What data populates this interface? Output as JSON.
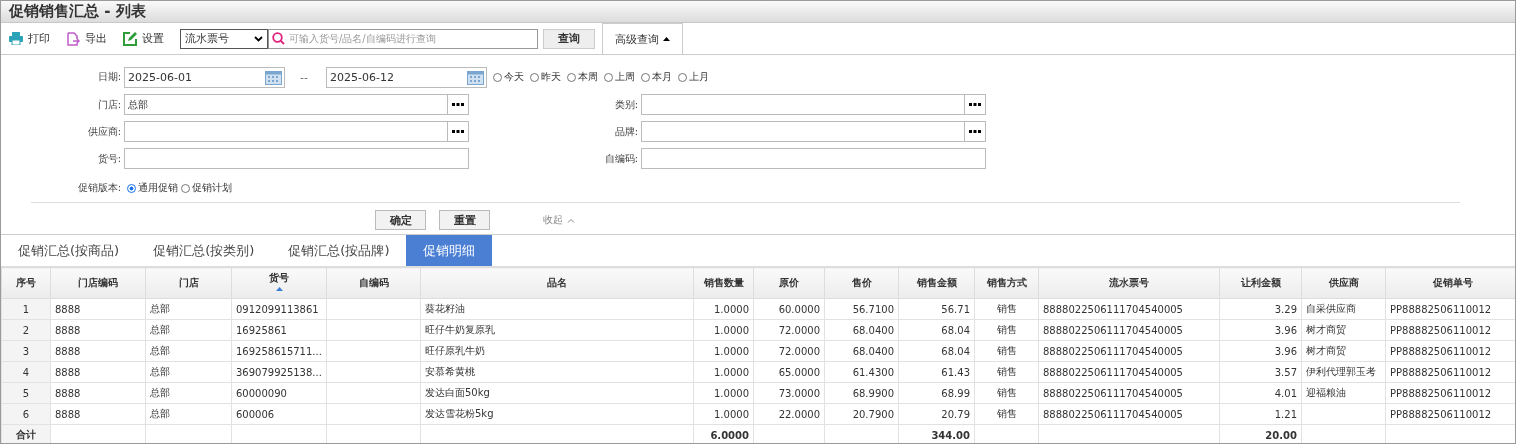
{
  "title": "促销销售汇总 - 列表",
  "toolbar": {
    "buttons": [
      {
        "label": "打印",
        "kind": "print"
      },
      {
        "label": "导出",
        "kind": "export"
      },
      {
        "label": "设置",
        "kind": "settings"
      }
    ],
    "select": {
      "value": "流水票号"
    },
    "search": {
      "placeholder": "可输入货号/品名/自编码进行查询"
    },
    "query_button": "查询",
    "advanced_tab": {
      "label": "高级查询",
      "expanded": true
    }
  },
  "filters": {
    "date": {
      "label": "日期:",
      "from": "2025-06-01",
      "separator": "--",
      "to": "2025-06-12",
      "quick": [
        {
          "label": "今天",
          "selected": false
        },
        {
          "label": "昨天",
          "selected": false
        },
        {
          "label": "本周",
          "selected": false
        },
        {
          "label": "上周",
          "selected": false
        },
        {
          "label": "本月",
          "selected": false
        },
        {
          "label": "上月",
          "selected": false
        }
      ]
    },
    "fields": [
      {
        "label": "门店:",
        "value": "总部",
        "picker": true
      },
      {
        "label": "类别:",
        "picker": true
      },
      {
        "label": "供应商:",
        "picker": true
      },
      {
        "label": "品牌:",
        "picker": true
      },
      {
        "label": "货号:",
        "picker": false
      },
      {
        "label": "自编码:",
        "picker": false
      }
    ],
    "promo_version": {
      "label": "促销版本:",
      "options": [
        {
          "label": "通用促销",
          "selected": true
        },
        {
          "label": "促销计划",
          "selected": false
        }
      ]
    },
    "confirm": "确定",
    "reset": "重置",
    "collapse": "收起"
  },
  "tabs": [
    {
      "label": "促销汇总(按商品)",
      "selected": false
    },
    {
      "label": "促销汇总(按类别)",
      "selected": false
    },
    {
      "label": "促销汇总(按品牌)",
      "selected": false
    },
    {
      "label": "促销明细",
      "selected": true
    }
  ],
  "table": {
    "columns": [
      {
        "label": "序号",
        "kind": "center",
        "sorted": false
      },
      {
        "label": "门店编码",
        "kind": "text",
        "sorted": false
      },
      {
        "label": "门店",
        "kind": "text",
        "sorted": false
      },
      {
        "label": "货号",
        "kind": "text",
        "sorted": true
      },
      {
        "label": "自编码",
        "kind": "text",
        "sorted": false
      },
      {
        "label": "品名",
        "kind": "text",
        "sorted": false
      },
      {
        "label": "销售数量",
        "kind": "number",
        "sorted": false
      },
      {
        "label": "原价",
        "kind": "number",
        "sorted": false
      },
      {
        "label": "售价",
        "kind": "number",
        "sorted": false
      },
      {
        "label": "销售金额",
        "kind": "number",
        "sorted": false
      },
      {
        "label": "销售方式",
        "kind": "center",
        "sorted": false
      },
      {
        "label": "流水票号",
        "kind": "text",
        "sorted": false
      },
      {
        "label": "让利金额",
        "kind": "number",
        "sorted": false
      },
      {
        "label": "供应商",
        "kind": "text",
        "sorted": false
      },
      {
        "label": "促销单号",
        "kind": "text",
        "sorted": false
      }
    ],
    "rows": [
      {
        "seq": "1",
        "store_code": "8888",
        "store": "总部",
        "item_no": "0912099113861",
        "name": "葵花籽油",
        "qty": "1.0000",
        "orig_price": "60.0000",
        "price": "56.7100",
        "amount": "56.71",
        "sale_type": "销售",
        "ticket_no": "8888022506111704540005",
        "discount": "3.29",
        "supplier": "自采供应商",
        "promo_no": "PP88882506110012"
      },
      {
        "seq": "2",
        "store_code": "8888",
        "store": "总部",
        "item_no": "16925861",
        "name": "旺仔牛奶复原乳",
        "qty": "1.0000",
        "orig_price": "72.0000",
        "price": "68.0400",
        "amount": "68.04",
        "sale_type": "销售",
        "ticket_no": "8888022506111704540005",
        "discount": "3.96",
        "supplier": "树才商贸",
        "promo_no": "PP88882506110012"
      },
      {
        "seq": "3",
        "store_code": "8888",
        "store": "总部",
        "item_no": "169258615711...",
        "name": "旺仔原乳牛奶",
        "qty": "1.0000",
        "orig_price": "72.0000",
        "price": "68.0400",
        "amount": "68.04",
        "sale_type": "销售",
        "ticket_no": "8888022506111704540005",
        "discount": "3.96",
        "supplier": "树才商贸",
        "promo_no": "PP88882506110012"
      },
      {
        "seq": "4",
        "store_code": "8888",
        "store": "总部",
        "item_no": "369079925138...",
        "name": "安慕希黄桃",
        "qty": "1.0000",
        "orig_price": "65.0000",
        "price": "61.4300",
        "amount": "61.43",
        "sale_type": "销售",
        "ticket_no": "8888022506111704540005",
        "discount": "3.57",
        "supplier": "伊利代理郭玉考",
        "promo_no": "PP88882506110012"
      },
      {
        "seq": "5",
        "store_code": "8888",
        "store": "总部",
        "item_no": "60000090",
        "name": "发达白面50kg",
        "qty": "1.0000",
        "orig_price": "73.0000",
        "price": "68.9900",
        "amount": "68.99",
        "sale_type": "销售",
        "ticket_no": "8888022506111704540005",
        "discount": "4.01",
        "supplier": "迎福粮油",
        "promo_no": "PP88882506110012"
      },
      {
        "seq": "6",
        "store_code": "8888",
        "store": "总部",
        "item_no": "600006",
        "name": "发达雪花粉5kg",
        "qty": "1.0000",
        "orig_price": "22.0000",
        "price": "20.7900",
        "amount": "20.79",
        "sale_type": "销售",
        "ticket_no": "8888022506111704540005",
        "discount": "1.21",
        "promo_no": "PP88882506110012"
      }
    ],
    "totals": {
      "seq": "合计",
      "qty": "6.0000",
      "amount": "344.00",
      "discount": "20.00"
    }
  }
}
